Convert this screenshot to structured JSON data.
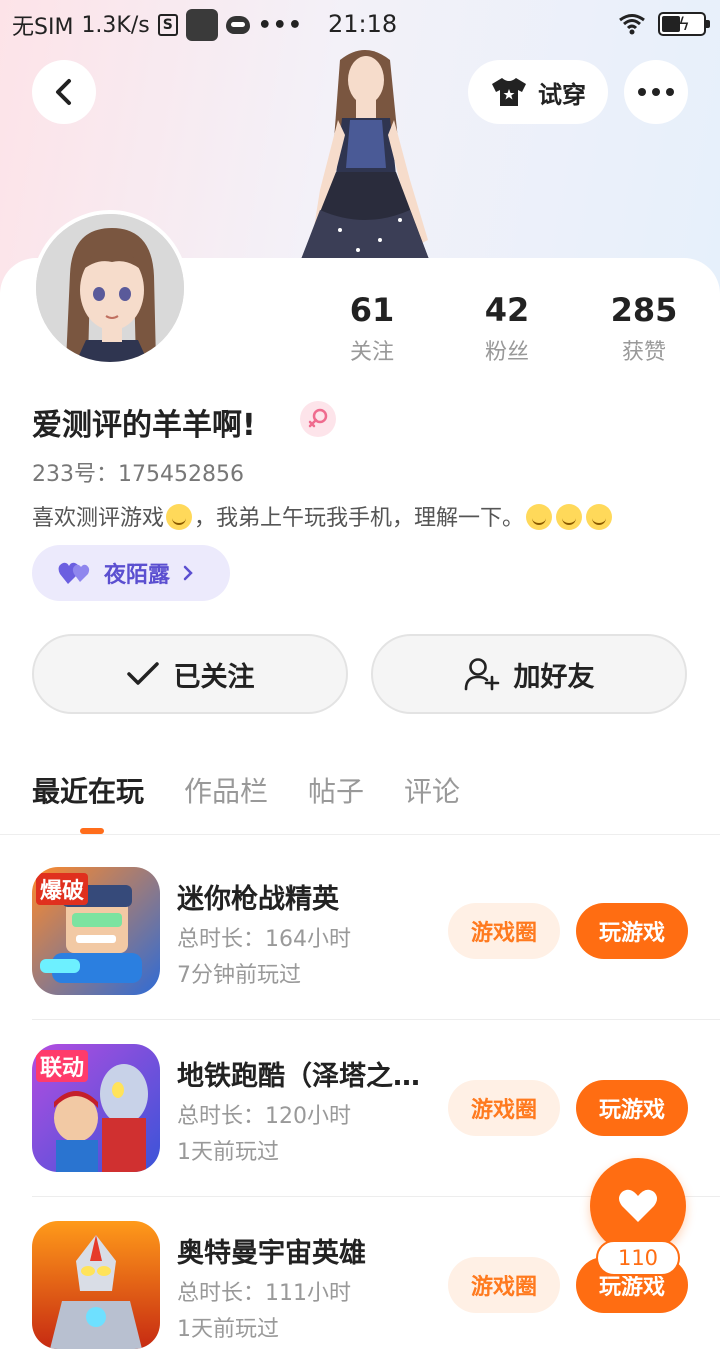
{
  "status_bar": {
    "carrier": "无SIM",
    "speed": "1.3K/s",
    "time": "21:18"
  },
  "header": {
    "try_on_label": "试穿"
  },
  "profile": {
    "username": "爱测评的羊羊啊!",
    "uid_text": "233号：175452856",
    "bio_text": "喜欢测评游戏",
    "bio_text_2": "，我弟上午玩我手机，理解一下。",
    "tag_label": "夜陌露",
    "stats": [
      {
        "value": "61",
        "label": "关注"
      },
      {
        "value": "42",
        "label": "粉丝"
      },
      {
        "value": "285",
        "label": "获赞"
      }
    ]
  },
  "actions": {
    "followed_label": "已关注",
    "add_friend_label": "加好友"
  },
  "tabs": [
    {
      "label": "最近在玩",
      "active": true
    },
    {
      "label": "作品栏",
      "active": false
    },
    {
      "label": "帖子",
      "active": false
    },
    {
      "label": "评论",
      "active": false
    }
  ],
  "games": [
    {
      "name": "迷你枪战精英",
      "duration": "总时长：164小时",
      "last_played": "7分钟前玩过",
      "circle_label": "游戏圈",
      "play_label": "玩游戏",
      "icon_badge": "爆破"
    },
    {
      "name": "地铁跑酷（泽塔之…",
      "duration": "总时长：120小时",
      "last_played": "1天前玩过",
      "circle_label": "游戏圈",
      "play_label": "玩游戏",
      "icon_badge": "联动"
    },
    {
      "name": "奥特曼宇宙英雄",
      "duration": "总时长：111小时",
      "last_played": "1天前玩过",
      "circle_label": "游戏圈",
      "play_label": "玩游戏",
      "icon_badge": ""
    }
  ],
  "like_fab": {
    "count": "110"
  },
  "colors": {
    "accent": "#ff6d12",
    "accent_soft": "#fff0e5",
    "tag_bg": "#eceafc",
    "tag_text": "#5b4fd0"
  }
}
